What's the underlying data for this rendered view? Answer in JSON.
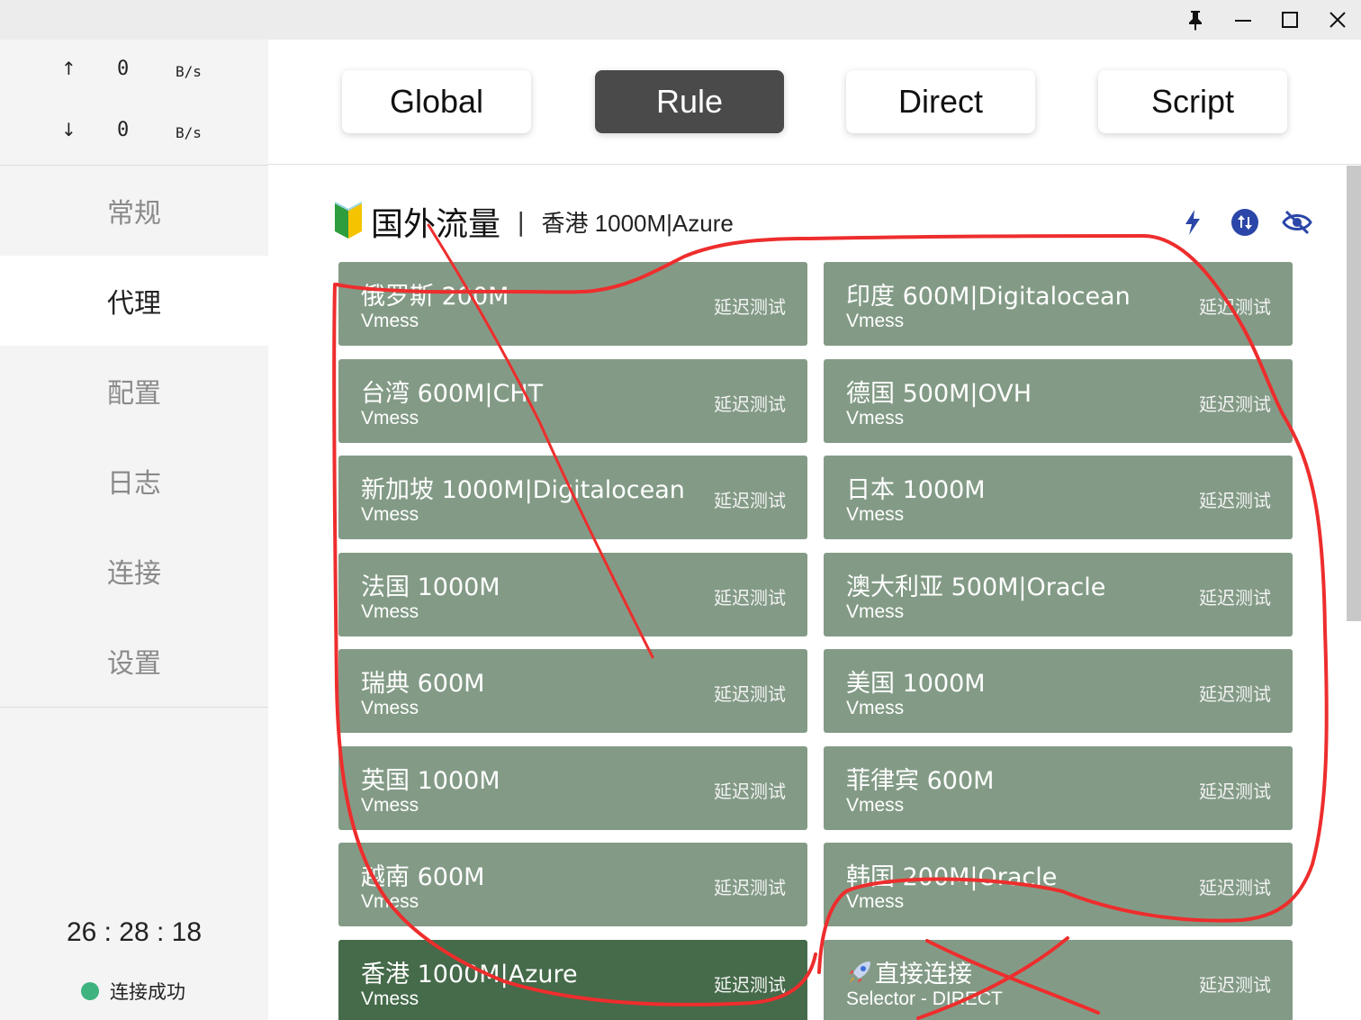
{
  "window": {
    "controls": [
      "pin-icon",
      "minimize-icon",
      "maximize-icon",
      "close-icon"
    ]
  },
  "traffic": {
    "up_arrow": "↑",
    "down_arrow": "↓",
    "up_value": "0",
    "down_value": "0",
    "up_unit": "B/s",
    "down_unit": "B/s"
  },
  "nav": {
    "items": [
      {
        "label": "常规"
      },
      {
        "label": "代理"
      },
      {
        "label": "配置"
      },
      {
        "label": "日志"
      },
      {
        "label": "连接"
      },
      {
        "label": "设置"
      }
    ],
    "active_index": 1
  },
  "clock": "26 : 28 : 18",
  "status": {
    "text": "连接成功",
    "color": "#3fb37f"
  },
  "modes": {
    "items": [
      {
        "label": "Global"
      },
      {
        "label": "Rule"
      },
      {
        "label": "Direct"
      },
      {
        "label": "Script"
      }
    ],
    "active_index": 1
  },
  "group": {
    "icon": "beginner-shield-icon",
    "title": "国外流量",
    "separator": "|",
    "current": "香港 1000M|Azure",
    "actions": [
      "lightning-icon",
      "sort-swap-icon",
      "eye-slash-icon"
    ]
  },
  "proxies": [
    {
      "name": "俄罗斯 200M",
      "type": "Vmess",
      "test": "延迟测试"
    },
    {
      "name": "印度 600M|Digitalocean",
      "type": "Vmess",
      "test": "延迟测试"
    },
    {
      "name": "台湾 600M|CHT",
      "type": "Vmess",
      "test": "延迟测试"
    },
    {
      "name": "德国 500M|OVH",
      "type": "Vmess",
      "test": "延迟测试"
    },
    {
      "name": "新加坡 1000M|Digitalocean",
      "type": "Vmess",
      "test": "延迟测试"
    },
    {
      "name": "日本 1000M",
      "type": "Vmess",
      "test": "延迟测试"
    },
    {
      "name": "法国 1000M",
      "type": "Vmess",
      "test": "延迟测试"
    },
    {
      "name": "澳大利亚 500M|Oracle",
      "type": "Vmess",
      "test": "延迟测试"
    },
    {
      "name": "瑞典 600M",
      "type": "Vmess",
      "test": "延迟测试"
    },
    {
      "name": "美国 1000M",
      "type": "Vmess",
      "test": "延迟测试"
    },
    {
      "name": "英国 1000M",
      "type": "Vmess",
      "test": "延迟测试"
    },
    {
      "name": "菲律宾 600M",
      "type": "Vmess",
      "test": "延迟测试"
    },
    {
      "name": "越南 600M",
      "type": "Vmess",
      "test": "延迟测试"
    },
    {
      "name": "韩国 200M|Oracle",
      "type": "Vmess",
      "test": "延迟测试"
    },
    {
      "name": "香港 1000M|Azure",
      "type": "Vmess",
      "test": "延迟测试",
      "selected": true
    },
    {
      "name": "直接连接",
      "icon": "rocket-icon",
      "type": "Selector - DIRECT",
      "test": "延迟测试"
    }
  ],
  "colors": {
    "card": "#839b86",
    "card_selected": "#456b4a",
    "mode_active": "#4a4a4a",
    "action_icon": "#2b46a8",
    "annotation": "#ee2d2d"
  }
}
